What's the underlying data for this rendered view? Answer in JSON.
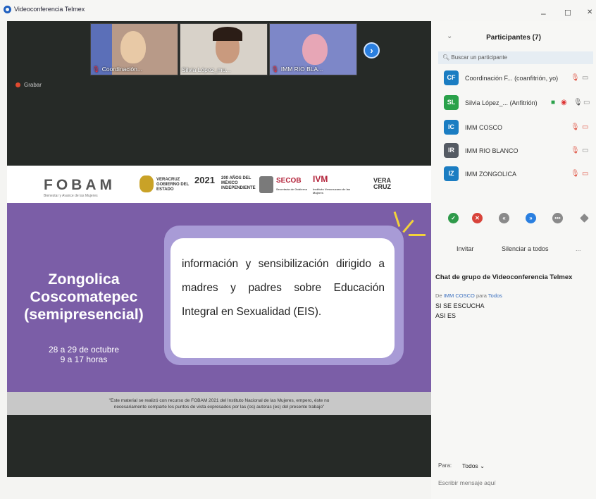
{
  "window": {
    "title": "Videoconferencia Telmex",
    "minimize": "–",
    "maximize": "☐",
    "close": "✕"
  },
  "thumbs": [
    {
      "name": "Coordinación..."
    },
    {
      "name": "Silvia López_mu..."
    },
    {
      "name": "IMM RIO BLA..."
    }
  ],
  "record_label": "Grabar",
  "slide": {
    "brand": "FOBAM",
    "brand_sub": "Bienestar y Avance de las Mujeres",
    "logos": [
      "VERACRUZ GOBIERNO DEL ESTADO",
      "2021",
      "200 AÑOS DEL MÉXICO INDEPENDIENTE",
      "SECOB",
      "Secretaría de Gobierno",
      "IVM",
      "Instituto Veracruzano de las Mujeres",
      "VERA CRUZ"
    ],
    "city_lines": [
      "Zongolica",
      "Coscomatepec",
      "(semipresencial)"
    ],
    "dates_lines": [
      "28 a 29 de octubre",
      "9 a 17 horas"
    ],
    "card_text": "información y sensibilización dirigido a madres y padres sobre Educación Integral en Sexualidad (EIS).",
    "note_lines": [
      "\"Este material se realizó con recurso de FOBAM 2021 del Instituto Nacional de las Mujeres, empero, éste no",
      "necesariamente comparte los puntos de vista expresados por las (os) autoras (es) del presente trabajo\""
    ]
  },
  "participants": {
    "title": "Participantes (7)",
    "search_placeholder": "Buscar un participante",
    "list": [
      {
        "initials": "CF",
        "color": "#1b7dc2",
        "name": "Coordinación F...",
        "role": "(coanfitrión, yo)"
      },
      {
        "initials": "SL",
        "color": "#2aa14a",
        "name": "Silvia López_...",
        "role": "(Anfitrión)"
      },
      {
        "initials": "IC",
        "color": "#1b7dc2",
        "name": "IMM COSCO",
        "role": ""
      },
      {
        "initials": "IR",
        "color": "#555b63",
        "name": "IMM RIO BLANCO",
        "role": ""
      },
      {
        "initials": "IZ",
        "color": "#1b7dc2",
        "name": "IMM ZONGOLICA",
        "role": ""
      }
    ],
    "invite": "Invitar",
    "mute_all": "Silenciar a todos",
    "more": "..."
  },
  "chat": {
    "title": "Chat de grupo de Videoconferencia Telmex",
    "from": "IMM COSCO",
    "from_word": "De",
    "to_word": "para",
    "to": "Todos",
    "messages": [
      "SI SE ESCUCHA",
      "ASI ES"
    ],
    "to_label": "Para:",
    "to_select": "Todos ⌄",
    "input_placeholder": "Escribir mensaje aquí"
  }
}
